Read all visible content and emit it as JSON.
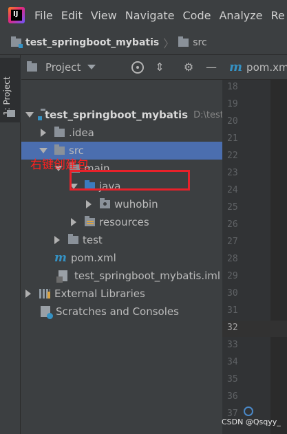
{
  "menubar": {
    "items": [
      "File",
      "Edit",
      "View",
      "Navigate",
      "Code",
      "Analyze",
      "Re"
    ]
  },
  "breadcrumb": {
    "project": "test_springboot_mybatis",
    "folder": "src"
  },
  "tool_stripe": {
    "label": "1: Project"
  },
  "project_panel": {
    "title": "Project"
  },
  "tree": [
    {
      "label": "test_springboot_mybatis",
      "hint": "D:\\test_"
    },
    {
      "label": ".idea"
    },
    {
      "label": "src"
    },
    {
      "label": "main"
    },
    {
      "label": "java"
    },
    {
      "label": "wuhobin"
    },
    {
      "label": "resources"
    },
    {
      "label": "test"
    },
    {
      "label": "pom.xml"
    },
    {
      "label": "test_springboot_mybatis.iml"
    },
    {
      "label": "External Libraries"
    },
    {
      "label": "Scratches and Consoles"
    }
  ],
  "annotation": {
    "text": "右键创建包"
  },
  "editor": {
    "tab_label": "pom.xm",
    "line_numbers": [
      "18",
      "19",
      "20",
      "21",
      "22",
      "23",
      "24",
      "25",
      "26",
      "27",
      "28",
      "29",
      "30",
      "31",
      "32",
      "33",
      "34",
      "35",
      "36",
      "37"
    ],
    "current_line": "32"
  },
  "watermark": "CSDN @Qsqyy_",
  "colors": {
    "selection": "#4b6eaf",
    "annotation": "#e8212a",
    "maven_icon": "#3592c4"
  }
}
